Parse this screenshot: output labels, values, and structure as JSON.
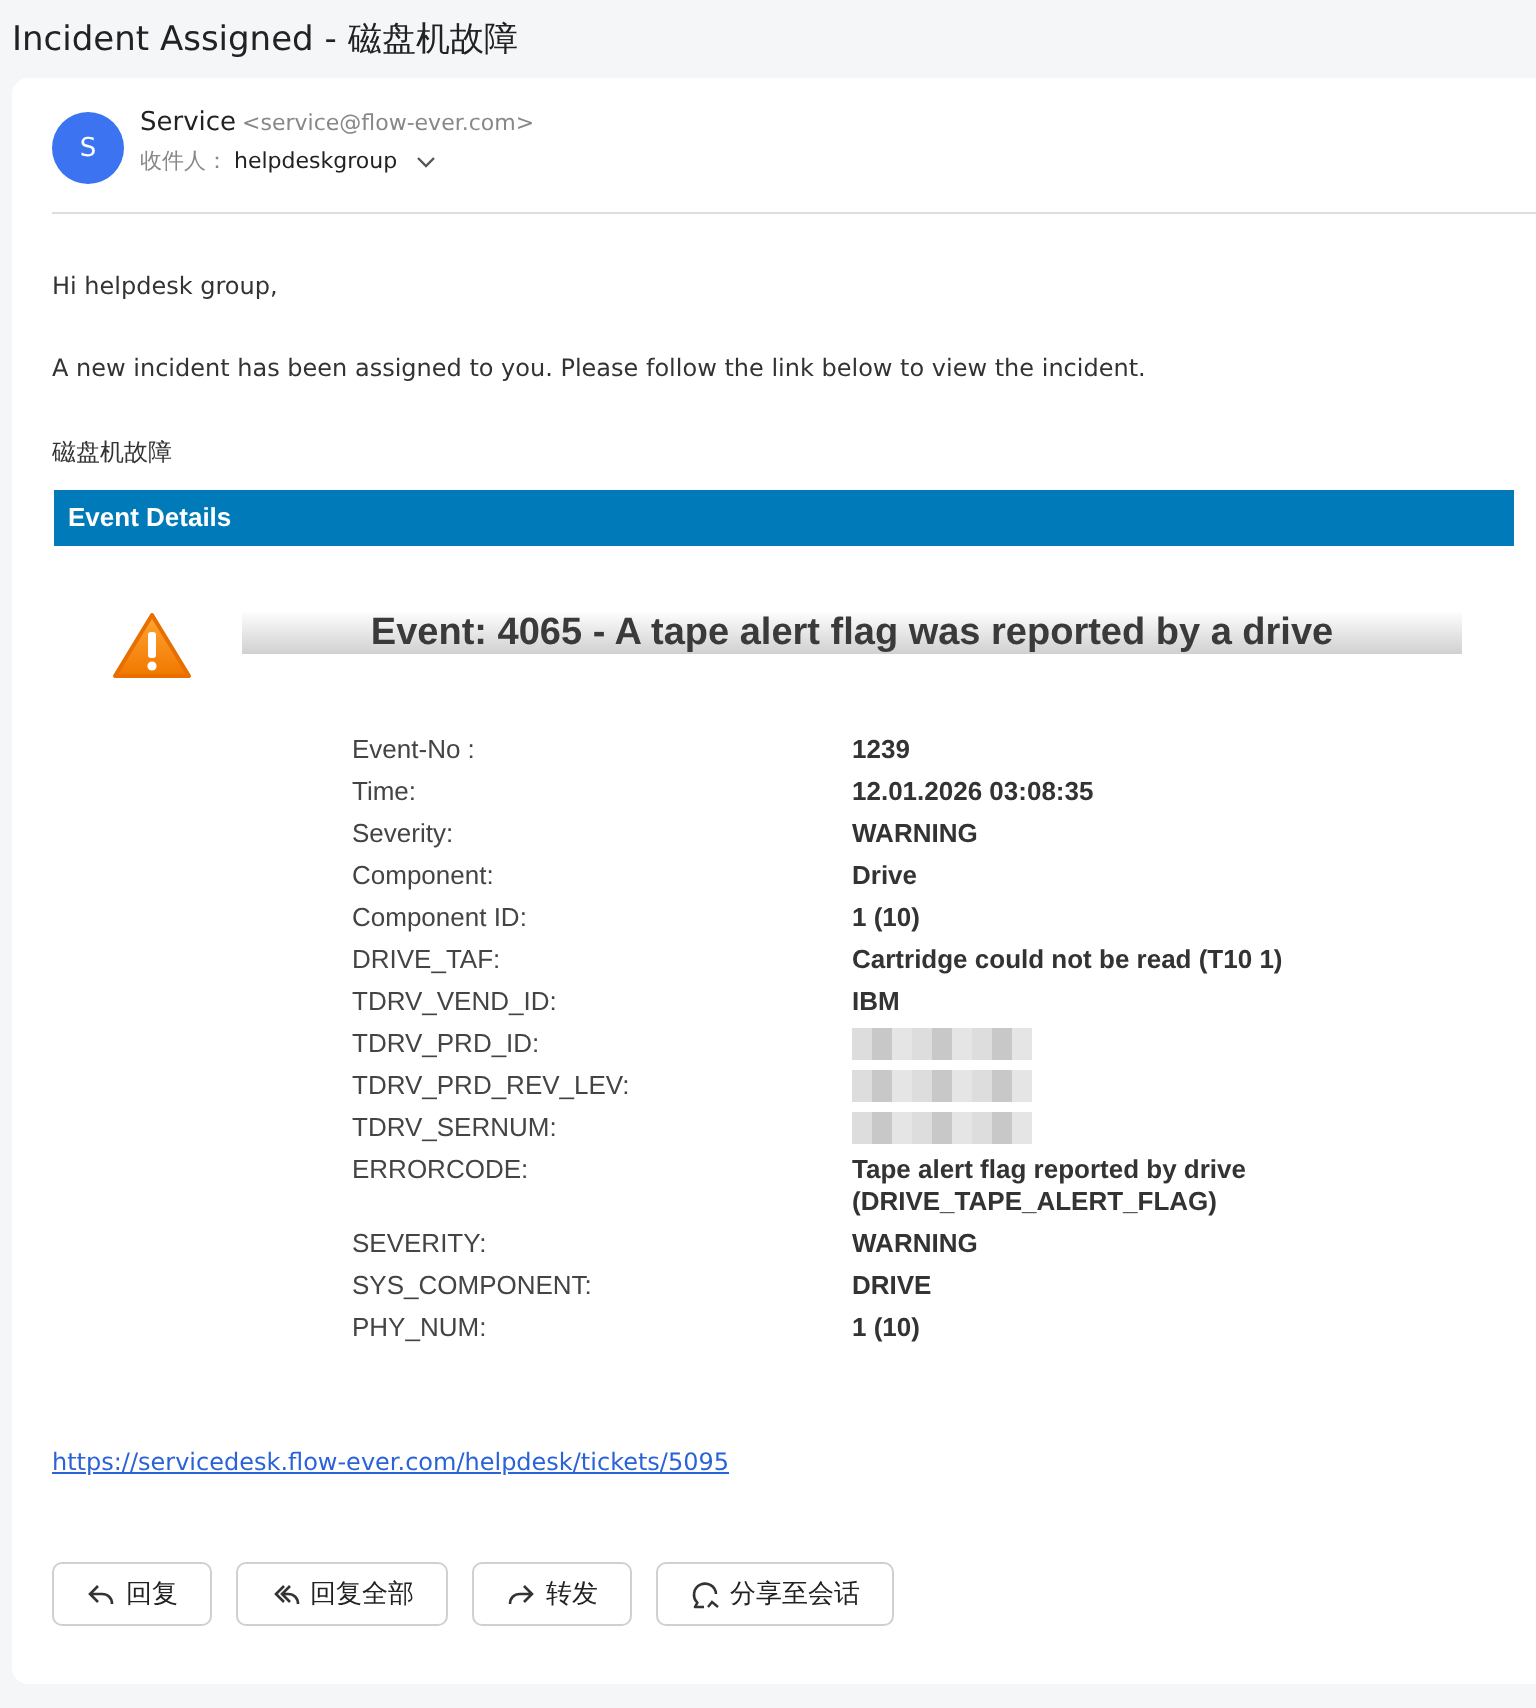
{
  "window": {
    "title": "Incident Assigned - 磁盘机故障"
  },
  "sender": {
    "avatar": "S",
    "name": "Service",
    "address": "<service@flow-ever.com>",
    "to_label": "收件人：",
    "to": "helpdeskgroup"
  },
  "body": {
    "greeting": "Hi helpdesk group,",
    "message": "A new incident has been assigned to you. Please follow the link below to view the incident.",
    "subject": "磁盘机故障"
  },
  "event": {
    "section_title": "Event Details",
    "headline": "Event: 4065 - A tape alert flag was reported by a drive",
    "rows": [
      {
        "label": "Event-No :",
        "value": "1239",
        "redacted": false
      },
      {
        "label": "Time:",
        "value": "12.01.2026 03:08:35",
        "redacted": false
      },
      {
        "label": "Severity:",
        "value": "WARNING",
        "redacted": false
      },
      {
        "label": "Component:",
        "value": "Drive",
        "redacted": false
      },
      {
        "label": "Component ID:",
        "value": "1 (10)",
        "redacted": false
      },
      {
        "label": "DRIVE_TAF:",
        "value": "Cartridge could not be read (T10 1)",
        "redacted": false
      },
      {
        "label": "TDRV_VEND_ID:",
        "value": "IBM",
        "redacted": false
      },
      {
        "label": "TDRV_PRD_ID:",
        "redacted": true
      },
      {
        "label": "TDRV_PRD_REV_LEV:",
        "redacted": true
      },
      {
        "label": "TDRV_SERNUM:",
        "redacted": true
      },
      {
        "label": "ERRORCODE:",
        "value": "Tape alert flag reported by drive (DRIVE_TAPE_ALERT_FLAG)",
        "redacted": false
      },
      {
        "label": "SEVERITY:",
        "value": "WARNING",
        "redacted": false
      },
      {
        "label": "SYS_COMPONENT:",
        "value": "DRIVE",
        "redacted": false
      },
      {
        "label": "PHY_NUM:",
        "value": "1 (10)",
        "redacted": false
      }
    ]
  },
  "link": "https://servicedesk.flow-ever.com/helpdesk/tickets/5095",
  "actions": [
    {
      "kind": "reply",
      "label": "回复"
    },
    {
      "kind": "reply_all",
      "label": "回复全部"
    },
    {
      "kind": "forward",
      "label": "转发"
    },
    {
      "kind": "share",
      "label": "分享至会话"
    }
  ]
}
